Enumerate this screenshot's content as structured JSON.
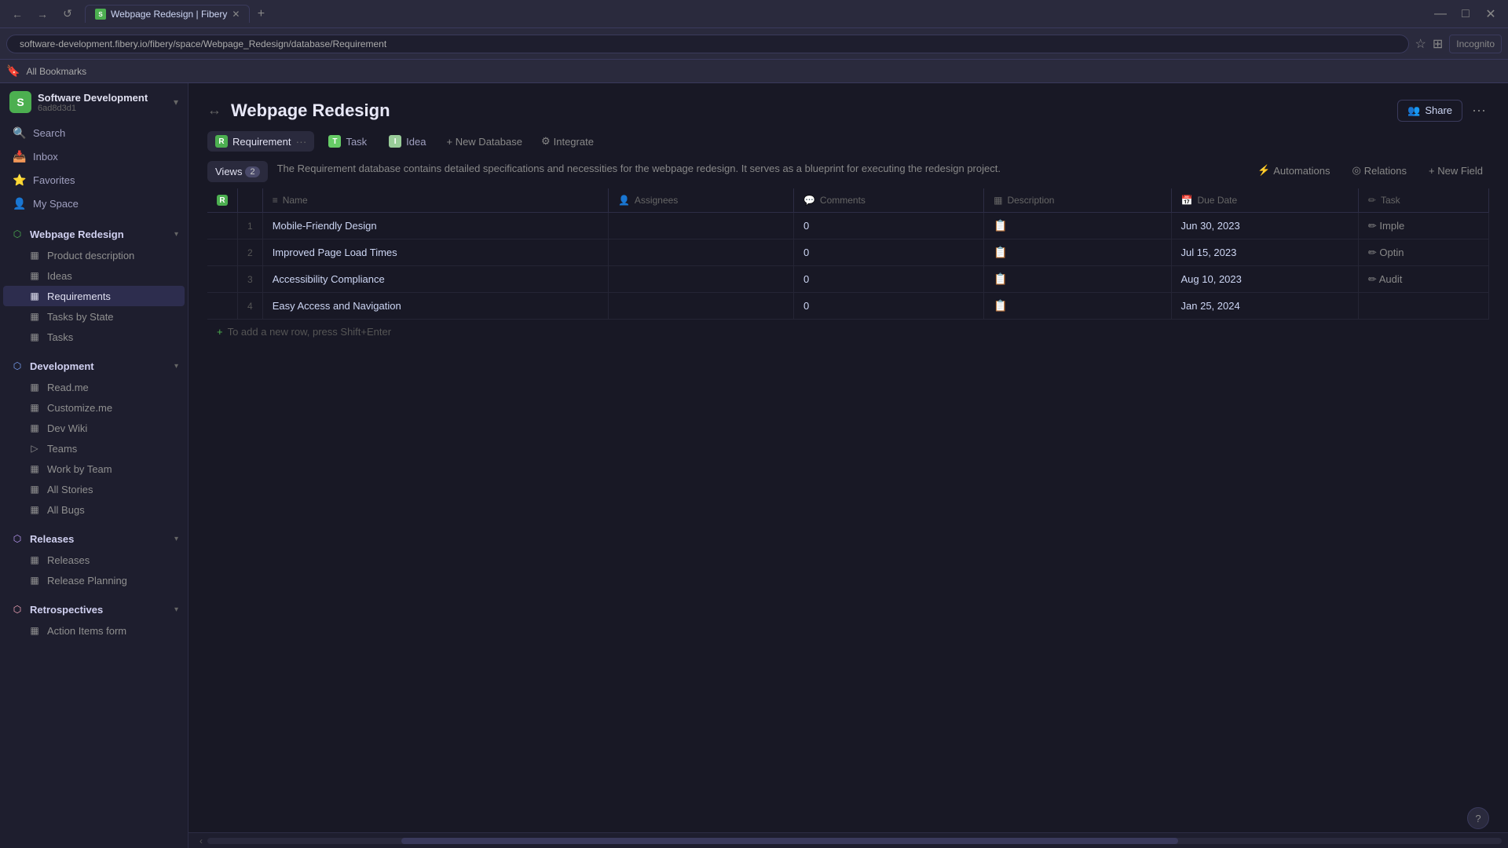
{
  "browser": {
    "tab_title": "Webpage Redesign | Fibery",
    "tab_favicon": "F",
    "url": "software-development.fibery.io/fibery/space/Webpage_Redesign/database/Requirement",
    "new_tab_label": "+",
    "back_btn": "←",
    "forward_btn": "→",
    "reload_btn": "↺",
    "bookmark_label": "☆",
    "bookmarks_bar_label": "All Bookmarks",
    "window_min": "—",
    "window_max": "□",
    "window_close": "✕",
    "incognito_label": "Incognito"
  },
  "sidebar": {
    "workspace_name": "Software Development",
    "workspace_id": "6ad8d3d1",
    "workspace_icon": "S",
    "collapse_icon": "‹",
    "search_label": "Search",
    "inbox_label": "Inbox",
    "favorites_label": "Favorites",
    "my_space_label": "My Space",
    "sections": [
      {
        "name": "Webpage Redesign",
        "icon": "⬡",
        "active": true,
        "children": [
          {
            "label": "Product description",
            "icon": "▦"
          },
          {
            "label": "Ideas",
            "icon": "▦"
          },
          {
            "label": "Requirements",
            "icon": "▦"
          },
          {
            "label": "Tasks by State",
            "icon": "▦"
          },
          {
            "label": "Tasks",
            "icon": "▦"
          }
        ]
      },
      {
        "name": "Development",
        "icon": "⬡",
        "children": [
          {
            "label": "Read.me",
            "icon": "▦"
          },
          {
            "label": "Customize.me",
            "icon": "▦"
          },
          {
            "label": "Dev Wiki",
            "icon": "▦"
          },
          {
            "label": "Teams",
            "icon": "▷"
          },
          {
            "label": "Work by Team",
            "icon": "▦"
          },
          {
            "label": "All Stories",
            "icon": "▦"
          },
          {
            "label": "All Bugs",
            "icon": "▦"
          }
        ]
      },
      {
        "name": "Releases",
        "icon": "⬡",
        "children": [
          {
            "label": "Releases",
            "icon": "▦"
          },
          {
            "label": "Release Planning",
            "icon": "▦"
          }
        ]
      },
      {
        "name": "Retrospectives",
        "icon": "⬡",
        "children": [
          {
            "label": "Action Items form",
            "icon": "▦"
          }
        ]
      }
    ]
  },
  "page": {
    "title": "Webpage Redesign",
    "back_forward_icon": "↔",
    "share_label": "Share",
    "share_icon": "👥",
    "more_icon": "···",
    "description": "The Requirement database contains detailed specifications and necessities for the webpage redesign. It serves as a blueprint for executing the redesign project.",
    "views_label": "Views",
    "views_count": "2",
    "automations_label": "Automations",
    "automations_icon": "⚡",
    "relations_label": "Relations",
    "relations_icon": "◎",
    "new_field_label": "+ New Field",
    "add_row_hint": "To add a new row, press Shift+Enter"
  },
  "db_tabs": [
    {
      "label": "Requirement",
      "icon": "R",
      "icon_class": "req",
      "active": true
    },
    {
      "label": "Task",
      "icon": "T",
      "icon_class": "task",
      "active": false
    },
    {
      "label": "Idea",
      "icon": "I",
      "icon_class": "idea",
      "active": false
    }
  ],
  "toolbar": {
    "new_db_label": "+ New Database",
    "integrate_label": "⚙ Integrate"
  },
  "table": {
    "columns": [
      {
        "label": "Name",
        "icon": "≡"
      },
      {
        "label": "Assignees",
        "icon": "👤"
      },
      {
        "label": "Comments",
        "icon": "💬"
      },
      {
        "label": "Description",
        "icon": "▦"
      },
      {
        "label": "Due Date",
        "icon": "📅"
      },
      {
        "label": "Task",
        "icon": "✏"
      }
    ],
    "rows": [
      {
        "num": "1",
        "name": "Mobile-Friendly Design",
        "assignees": "",
        "comments": "0",
        "description": "📋",
        "due_date": "Jun 30, 2023",
        "task": "✏ Imple"
      },
      {
        "num": "2",
        "name": "Improved Page Load Times",
        "assignees": "",
        "comments": "0",
        "description": "📋",
        "due_date": "Jul 15, 2023",
        "task": "✏ Optin"
      },
      {
        "num": "3",
        "name": "Accessibility Compliance",
        "assignees": "",
        "comments": "0",
        "description": "📋",
        "due_date": "Aug 10, 2023",
        "task": "✏ Audit"
      },
      {
        "num": "4",
        "name": "Easy Access and Navigation",
        "assignees": "",
        "comments": "0",
        "description": "📋",
        "due_date": "Jan 25, 2024",
        "task": ""
      }
    ]
  },
  "help_btn_label": "?"
}
